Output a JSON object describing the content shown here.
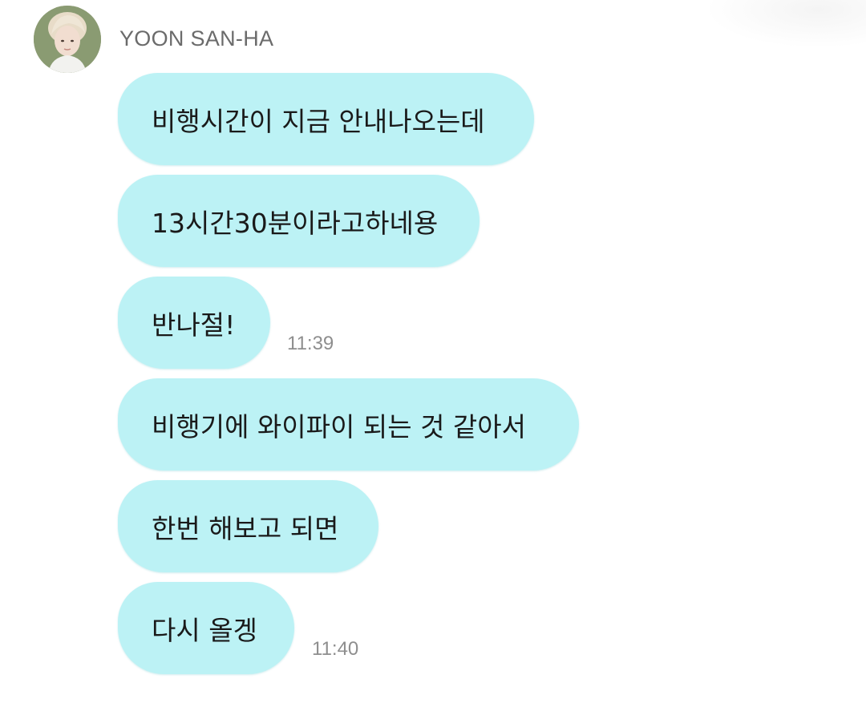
{
  "sender": {
    "name": "YOON SAN-HA"
  },
  "messages": [
    {
      "text": "비행시간이 지금 안내나오는데",
      "time": ""
    },
    {
      "text": "13시간30분이라고하네용",
      "time": ""
    },
    {
      "text": "반나절!",
      "time": "11:39"
    },
    {
      "text": "비행기에 와이파이 되는 것 같아서",
      "time": ""
    },
    {
      "text": "한번 해보고 되면",
      "time": ""
    },
    {
      "text": "다시 올겡",
      "time": "11:40"
    }
  ],
  "colors": {
    "bubble": "#bcf2f5",
    "sender_name": "#6b6b6b",
    "timestamp": "#8e8e8e"
  }
}
